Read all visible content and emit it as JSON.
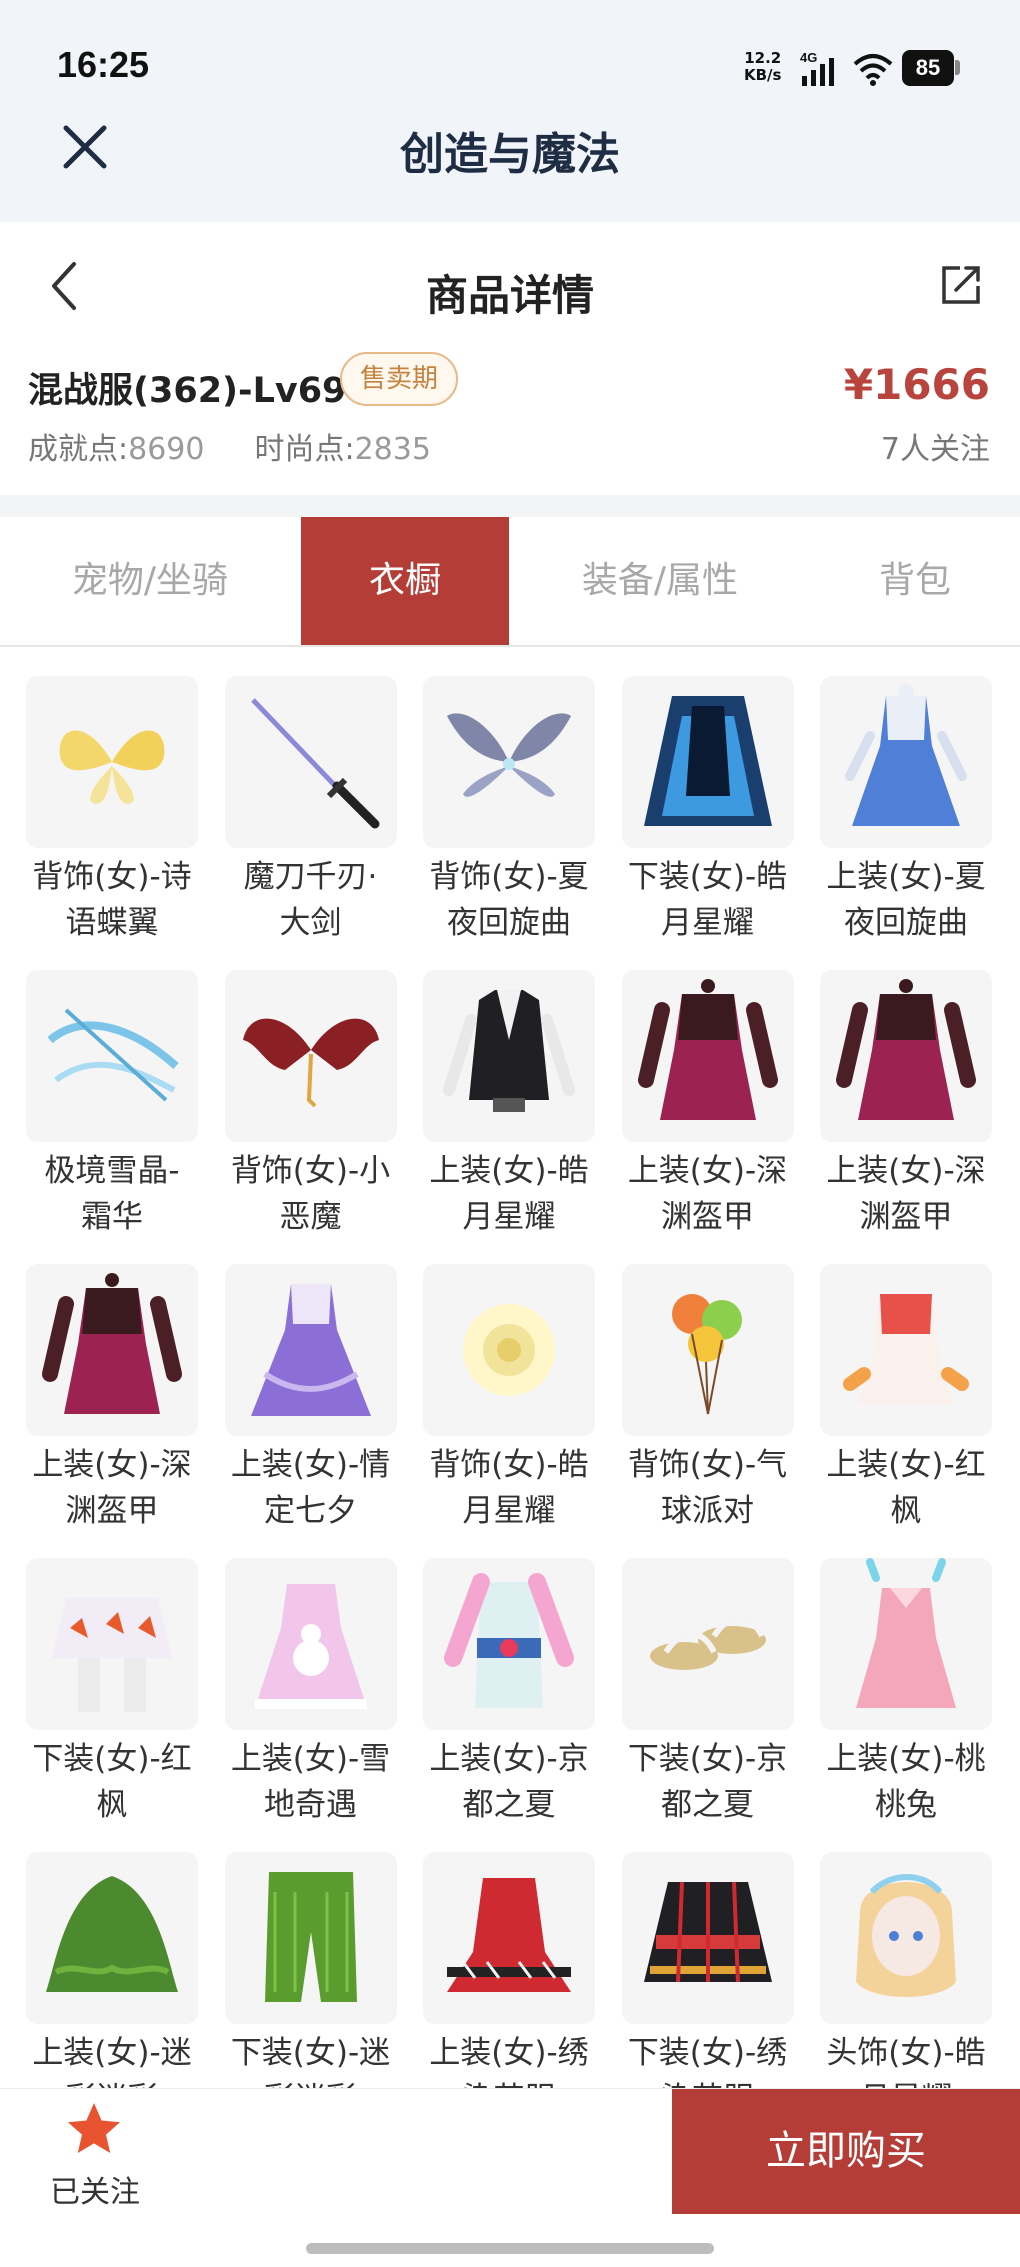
{
  "status_bar": {
    "time": "16:25",
    "net_speed_top": "12.2",
    "net_speed_bottom": "KB/s",
    "network": "4G",
    "battery": "85"
  },
  "app": {
    "title": "创造与魔法",
    "close_icon": "close-icon"
  },
  "page": {
    "title": "商品详情",
    "back_icon": "chevron-left-icon",
    "share_icon": "share-icon"
  },
  "product": {
    "name": "混战服(362)-Lv69",
    "status_badge": "售卖期",
    "price": "¥1666",
    "achievement_label": "成就点:",
    "achievement_value": "8690",
    "fashion_label": "时尚点:",
    "fashion_value": "2835",
    "follows": "7人关注"
  },
  "tabs": [
    {
      "label": "宠物/坐骑",
      "active": false
    },
    {
      "label": "衣橱",
      "active": true
    },
    {
      "label": "装备/属性",
      "active": false
    },
    {
      "label": "背包",
      "active": false
    }
  ],
  "items": [
    {
      "line1": "背饰(女)-诗",
      "line2": "语蝶翼",
      "icon": "butterfly-wings-icon"
    },
    {
      "line1": "魔刀千刃·",
      "line2": "大剑",
      "icon": "sword-icon"
    },
    {
      "line1": "背饰(女)-夏",
      "line2": "夜回旋曲",
      "icon": "fairy-wings-icon"
    },
    {
      "line1": "下装(女)-皓",
      "line2": "月星耀",
      "icon": "skirt-icon"
    },
    {
      "line1": "上装(女)-夏",
      "line2": "夜回旋曲",
      "icon": "dress-icon"
    },
    {
      "line1": "极境雪晶-",
      "line2": "霜华",
      "icon": "crossbow-icon"
    },
    {
      "line1": "背饰(女)-小",
      "line2": "恶魔",
      "icon": "devil-wings-icon"
    },
    {
      "line1": "上装(女)-皓",
      "line2": "月星耀",
      "icon": "vest-icon"
    },
    {
      "line1": "上装(女)-深",
      "line2": "渊盔甲",
      "icon": "armor-icon"
    },
    {
      "line1": "上装(女)-深",
      "line2": "渊盔甲",
      "icon": "armor-icon"
    },
    {
      "line1": "上装(女)-深",
      "line2": "渊盔甲",
      "icon": "armor-icon"
    },
    {
      "line1": "上装(女)-情",
      "line2": "定七夕",
      "icon": "gown-icon"
    },
    {
      "line1": "背饰(女)-皓",
      "line2": "月星耀",
      "icon": "glow-orb-icon"
    },
    {
      "line1": "背饰(女)-气",
      "line2": "球派对",
      "icon": "balloons-icon"
    },
    {
      "line1": "上装(女)-红",
      "line2": "枫",
      "icon": "maple-top-icon"
    },
    {
      "line1": "下装(女)-红",
      "line2": "枫",
      "icon": "maple-skirt-icon"
    },
    {
      "line1": "上装(女)-雪",
      "line2": "地奇遇",
      "icon": "snow-dress-icon"
    },
    {
      "line1": "上装(女)-京",
      "line2": "都之夏",
      "icon": "kimono-icon"
    },
    {
      "line1": "下装(女)-京",
      "line2": "都之夏",
      "icon": "sandals-icon"
    },
    {
      "line1": "上装(女)-桃",
      "line2": "桃兔",
      "icon": "bunny-dress-icon"
    },
    {
      "line1": "上装(女)-迷",
      "line2": "彩迷彩",
      "icon": "ghillie-top-icon"
    },
    {
      "line1": "下装(女)-迷",
      "line2": "彩迷彩",
      "icon": "ghillie-pants-icon"
    },
    {
      "line1": "上装(女)-绣",
      "line2": "染苗服",
      "icon": "embroidered-top-icon"
    },
    {
      "line1": "下装(女)-绣",
      "line2": "染苗服",
      "icon": "embroidered-skirt-icon"
    },
    {
      "line1": "头饰(女)-皓",
      "line2": "月星耀",
      "icon": "head-icon"
    }
  ],
  "bottom_bar": {
    "follow_label": "已关注",
    "follow_icon": "star-icon",
    "buy_label": "立即购买"
  },
  "colors": {
    "accent": "#b53d37",
    "price": "#b9443e",
    "badge_text": "#c6823e",
    "header_bg": "#f1f4f8"
  }
}
